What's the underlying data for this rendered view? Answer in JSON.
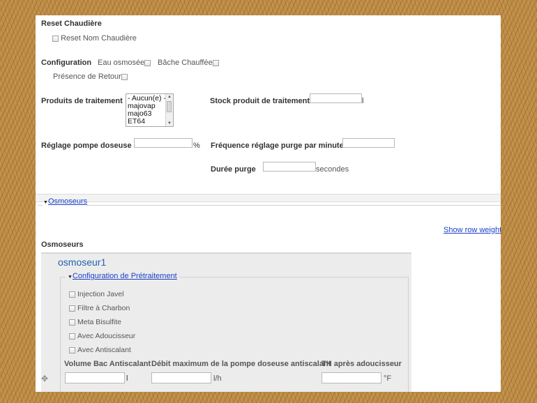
{
  "reset": {
    "title": "Reset Chaudière",
    "nom_label": "Reset Nom Chaudière"
  },
  "config": {
    "label": "Configuration",
    "eau_label": "Eau osmosée",
    "bache_label": "Bâche Chauffée",
    "retour_label": "Présence de Retour"
  },
  "produits": {
    "label": "Produits de traitement",
    "options": [
      "- Aucun(e) -",
      "majovap",
      "majo63",
      "ET64"
    ],
    "stock_label": "Stock produit de traitement",
    "stock_unit": "l"
  },
  "pompe": {
    "label": "Réglage pompe doseuse",
    "unit": "%",
    "freq_label": "Fréquence réglage purge par minute",
    "duree_label": "Durée purge",
    "duree_unit": "secondes"
  },
  "osmoseurs_section": {
    "toggle_icon": "triangle-down-icon",
    "link": "Osmoseurs",
    "show_weights": "Show row weights",
    "heading": "Osmoseurs"
  },
  "osmoseur1": {
    "title": "osmoseur1",
    "pretraitement_link": "Configuration de Prétraitement",
    "options": [
      "Injection Javel",
      "Filtre à Charbon",
      "Meta Bisulfite",
      "Avec Adoucisseur",
      "Avec Antiscalant"
    ],
    "volume_label": "Volume Bac Antiscalant",
    "volume_unit": "l",
    "debit_label": "Débit maximum de la pompe doseuse antiscalant",
    "debit_unit": "l/h",
    "th_label": "TH après adoucisseur",
    "th_unit": "°F",
    "drag_icon": "drag-handle-icon"
  }
}
